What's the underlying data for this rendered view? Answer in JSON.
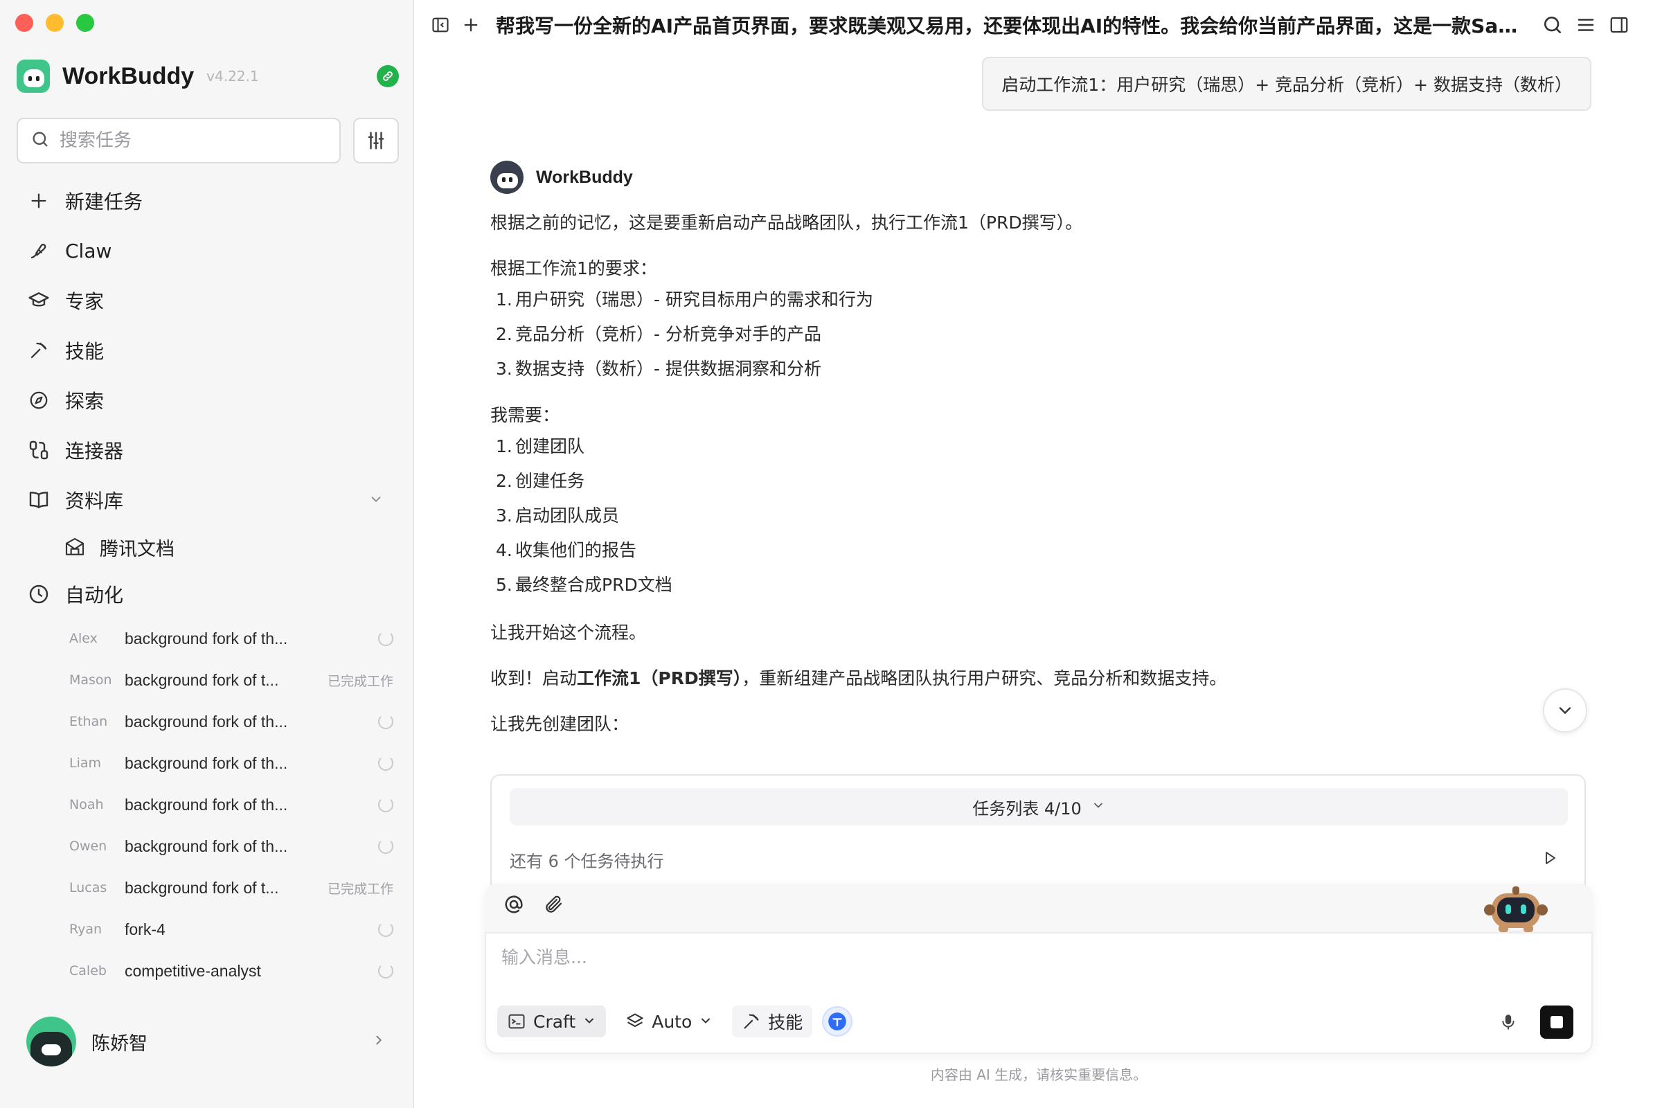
{
  "app": {
    "name": "WorkBuddy",
    "version": "v4.22.1"
  },
  "sidebar": {
    "search_placeholder": "搜索任务",
    "nav": [
      {
        "label": "新建任务",
        "icon": "plus-icon"
      },
      {
        "label": "Claw",
        "icon": "claw-icon"
      },
      {
        "label": "专家",
        "icon": "graduation-cap-icon"
      },
      {
        "label": "技能",
        "icon": "pickaxe-icon"
      },
      {
        "label": "探索",
        "icon": "compass-icon"
      },
      {
        "label": "连接器",
        "icon": "connector-icon"
      },
      {
        "label": "资料库",
        "icon": "book-icon"
      }
    ],
    "library_sub": {
      "label": "腾讯文档",
      "icon": "tencent-docs-icon"
    },
    "automation": {
      "label": "自动化",
      "icon": "clock-icon"
    },
    "automation_items": [
      {
        "name": "Alex",
        "title": "background fork of th...",
        "status": "running"
      },
      {
        "name": "Mason",
        "title": "background fork of t...",
        "status": "已完成工作"
      },
      {
        "name": "Ethan",
        "title": "background fork of th...",
        "status": "running"
      },
      {
        "name": "Liam",
        "title": "background fork of th...",
        "status": "running"
      },
      {
        "name": "Noah",
        "title": "background fork of th...",
        "status": "running"
      },
      {
        "name": "Owen",
        "title": "background fork of th...",
        "status": "running"
      },
      {
        "name": "Lucas",
        "title": "background fork of t...",
        "status": "已完成工作"
      },
      {
        "name": "Ryan",
        "title": "fork-4",
        "status": "running"
      },
      {
        "name": "Caleb",
        "title": "competitive-analyst",
        "status": "running"
      }
    ],
    "user": {
      "name": "陈娇智"
    }
  },
  "topbar": {
    "title": "帮我写一份全新的AI产品首页界面，要求既美观又易用，还要体现出AI的特性。我会给你当前产品界面，这是一款Saa..."
  },
  "chat": {
    "user_message": "启动工作流1：用户研究（瑞思）+ 竞品分析（竞析）+ 数据支持（数析）",
    "assistant_name": "WorkBuddy",
    "intro": "根据之前的记忆，这是要重新启动产品战略团队，执行工作流1（PRD撰写）。",
    "req_heading": "根据工作流1的要求：",
    "req_items": [
      "用户研究（瑞思）- 研究目标用户的需求和行为",
      "竞品分析（竞析）- 分析竞争对手的产品",
      "数据支持（数析）- 提供数据洞察和分析"
    ],
    "need_heading": "我需要：",
    "need_items": [
      "创建团队",
      "创建任务",
      "启动团队成员",
      "收集他们的报告",
      "最终整合成PRD文档"
    ],
    "start_line": "让我开始这个流程。",
    "ack_prefix": "收到！启动",
    "ack_bold": "工作流1（PRD撰写）",
    "ack_suffix": "，重新组建产品战略团队执行用户研究、竞品分析和数据支持。",
    "create_team_line": "让我先创建团队："
  },
  "task_panel": {
    "header": "任务列表 4/10",
    "pending": "还有 6 个任务待执行"
  },
  "composer": {
    "placeholder": "输入消息...",
    "mode_label": "Craft",
    "model_label": "Auto",
    "skill_label": "技能"
  },
  "footer": {
    "disclaimer": "内容由 AI 生成，请核实重要信息。"
  },
  "colors": {
    "brand_green": "#3fc58a",
    "link_badge_green": "#22b24c",
    "sidebar_bg": "#f6f6f7"
  }
}
